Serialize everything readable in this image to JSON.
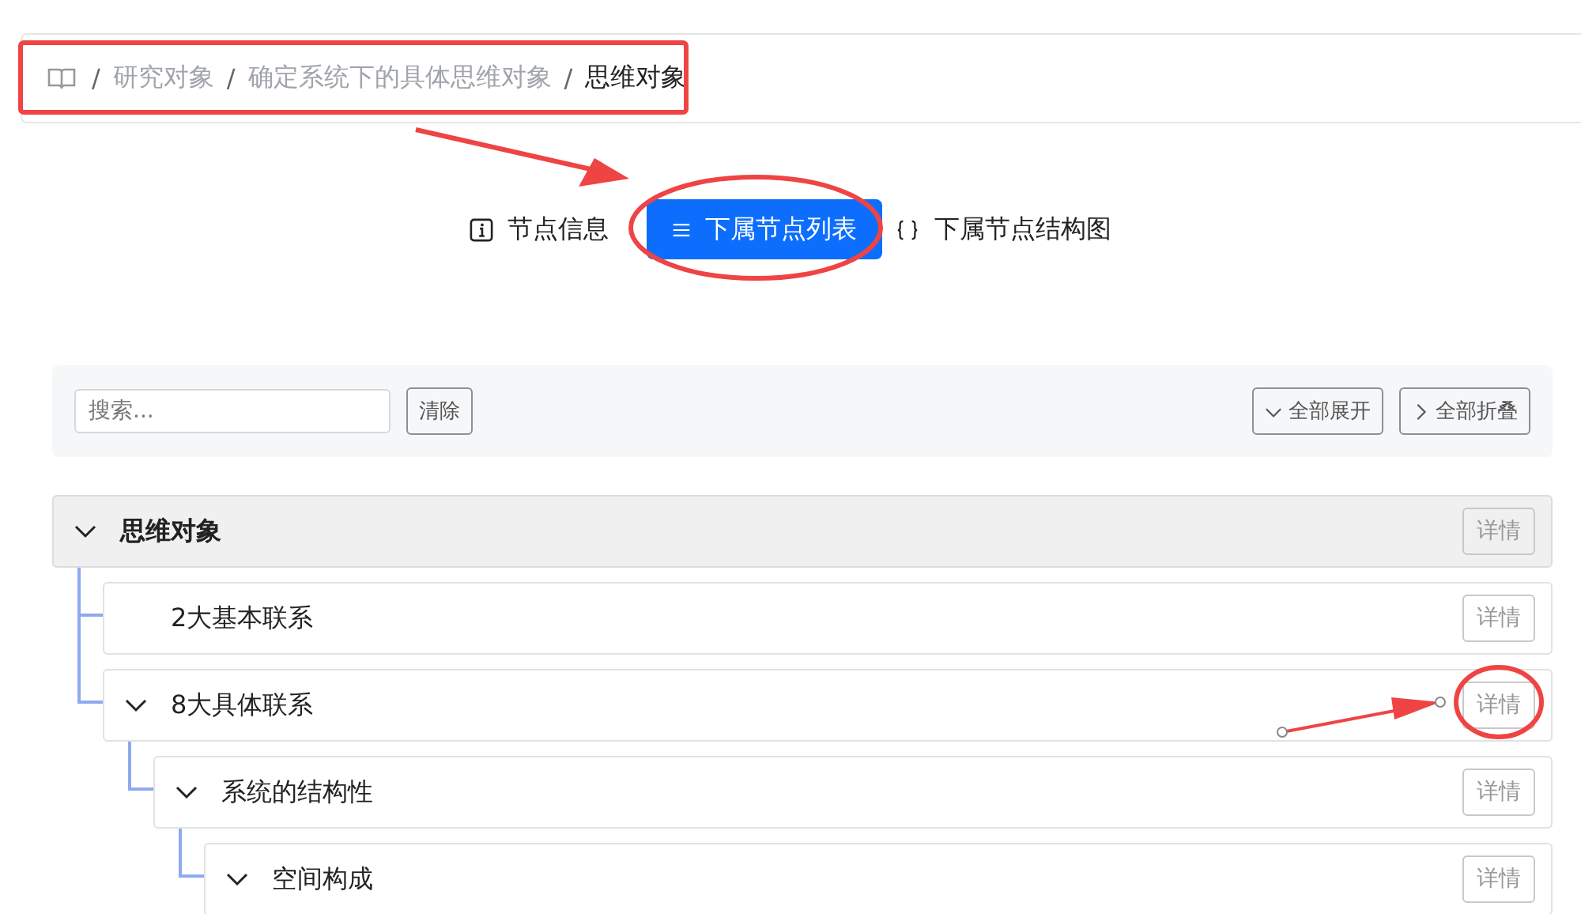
{
  "breadcrumb": {
    "separator": "/",
    "items": [
      "研究对象",
      "确定系统下的具体思维对象",
      "思维对象"
    ]
  },
  "tabs": [
    {
      "label": "节点信息",
      "kind": "info",
      "selected": false
    },
    {
      "label": "下属节点列表",
      "kind": "list",
      "selected": true
    },
    {
      "label": "下属节点结构图",
      "kind": "braces",
      "selected": false
    }
  ],
  "toolbar": {
    "search": {
      "placeholder": "搜索..."
    },
    "clear": "清除",
    "expand_all": "全部展开",
    "collapse_all": "全部折叠"
  },
  "tree": {
    "label": "思维对象",
    "expanded": true,
    "detail": "详情",
    "children": [
      {
        "label": "2大基本联系",
        "expanded": false,
        "detail": "详情"
      },
      {
        "label": "8大具体联系",
        "expanded": true,
        "detail": "详情",
        "children": [
          {
            "label": "系统的结构性",
            "expanded": true,
            "detail": "详情",
            "children": [
              {
                "label": "空间构成",
                "expanded": true,
                "detail": "详情"
              }
            ]
          }
        ]
      }
    ]
  }
}
